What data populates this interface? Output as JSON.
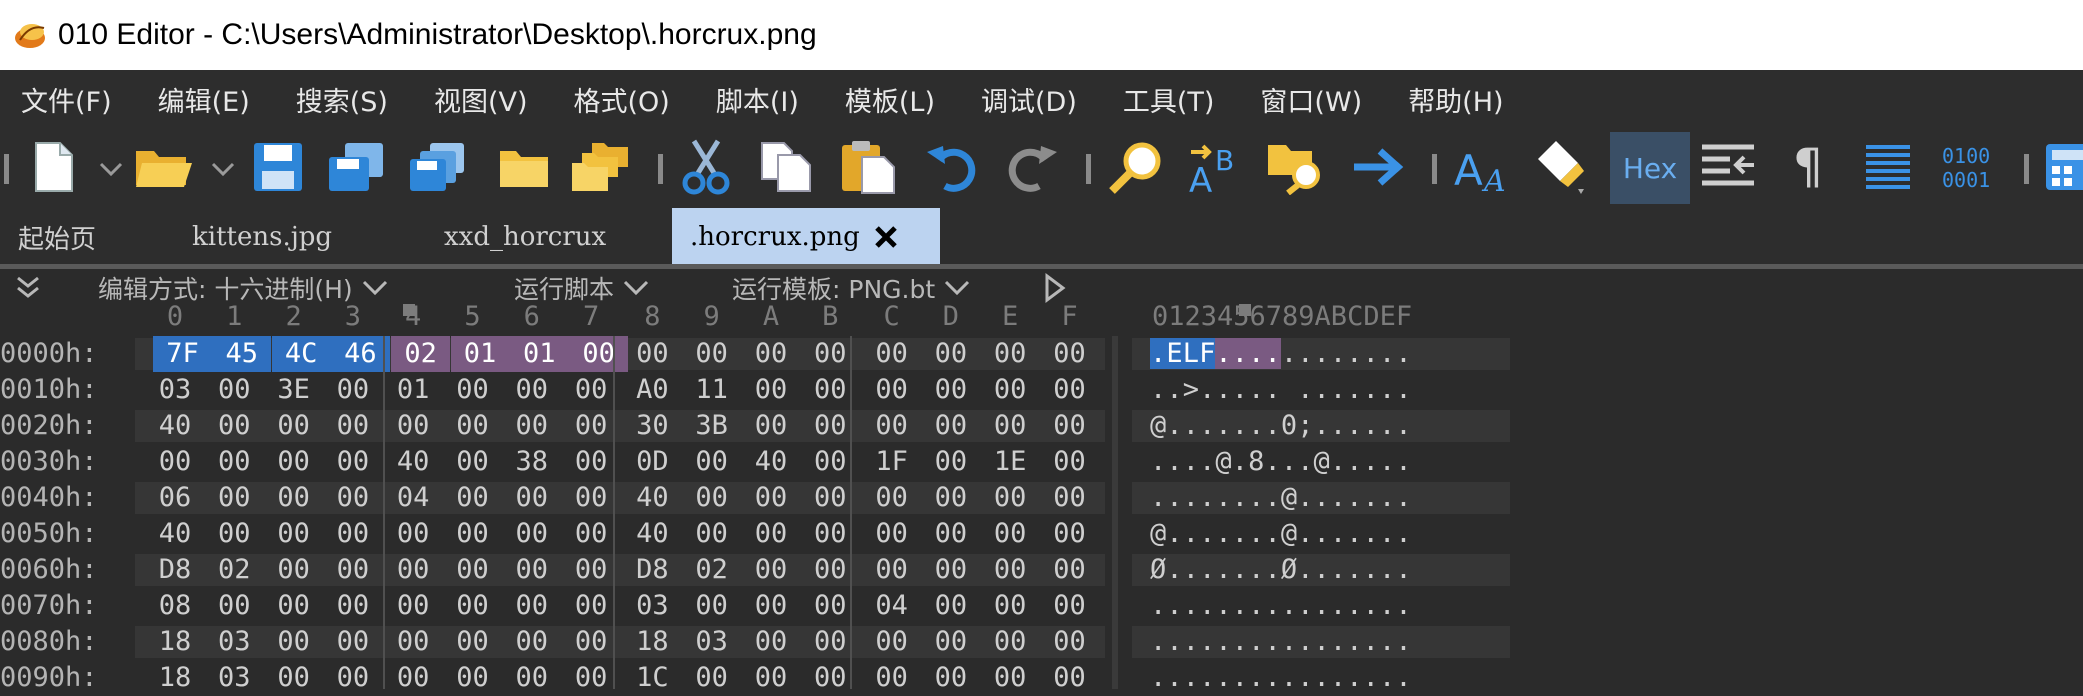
{
  "window": {
    "title": "010 Editor - C:\\Users\\Administrator\\Desktop\\.horcrux.png"
  },
  "menu": [
    "文件(F)",
    "编辑(E)",
    "搜索(S)",
    "视图(V)",
    "格式(O)",
    "脚本(I)",
    "模板(L)",
    "调试(D)",
    "工具(T)",
    "窗口(W)",
    "帮助(H)"
  ],
  "toolbar": {
    "icons": [
      "new-file-icon",
      "open-folder-icon",
      "save-icon",
      "save-as-icon",
      "save-all-icon",
      "folder-icon",
      "folders-icon",
      "cut-icon",
      "copy-icon",
      "paste-icon",
      "undo-icon",
      "redo-icon",
      "find-icon",
      "replace-icon",
      "find-in-files-icon",
      "goto-icon",
      "font-icon",
      "highlight-icon",
      "hex-mode-icon",
      "compare-icon",
      "pilcrow-icon",
      "columns-icon",
      "binary-icon",
      "calculator-icon"
    ],
    "hex_label": "Hex",
    "binary_label": "0100\n0001"
  },
  "tabs": [
    {
      "label": "起始页"
    },
    {
      "label": "kittens.jpg"
    },
    {
      "label": "xxd_horcrux"
    },
    {
      "label": ".horcrux.png",
      "active": true
    }
  ],
  "options": {
    "edit_mode": "编辑方式: 十六进制(H)",
    "run_script": "运行脚本",
    "run_template": "运行模板: PNG.bt"
  },
  "hex": {
    "column_headers": [
      "0",
      "1",
      "2",
      "3",
      "4",
      "5",
      "6",
      "7",
      "8",
      "9",
      "A",
      "B",
      "C",
      "D",
      "E",
      "F"
    ],
    "ascii_header": "0123456789ABCDEF",
    "rows": [
      {
        "addr": "0000h:",
        "bytes": [
          "7F",
          "45",
          "4C",
          "46",
          "02",
          "01",
          "01",
          "00",
          "00",
          "00",
          "00",
          "00",
          "00",
          "00",
          "00",
          "00"
        ],
        "ascii": ".ELF............"
      },
      {
        "addr": "0010h:",
        "bytes": [
          "03",
          "00",
          "3E",
          "00",
          "01",
          "00",
          "00",
          "00",
          "A0",
          "11",
          "00",
          "00",
          "00",
          "00",
          "00",
          "00"
        ],
        "ascii": "..>..... ......."
      },
      {
        "addr": "0020h:",
        "bytes": [
          "40",
          "00",
          "00",
          "00",
          "00",
          "00",
          "00",
          "00",
          "30",
          "3B",
          "00",
          "00",
          "00",
          "00",
          "00",
          "00"
        ],
        "ascii": "@.......0;......"
      },
      {
        "addr": "0030h:",
        "bytes": [
          "00",
          "00",
          "00",
          "00",
          "40",
          "00",
          "38",
          "00",
          "0D",
          "00",
          "40",
          "00",
          "1F",
          "00",
          "1E",
          "00"
        ],
        "ascii": "....@.8...@....."
      },
      {
        "addr": "0040h:",
        "bytes": [
          "06",
          "00",
          "00",
          "00",
          "04",
          "00",
          "00",
          "00",
          "40",
          "00",
          "00",
          "00",
          "00",
          "00",
          "00",
          "00"
        ],
        "ascii": "........@......."
      },
      {
        "addr": "0050h:",
        "bytes": [
          "40",
          "00",
          "00",
          "00",
          "00",
          "00",
          "00",
          "00",
          "40",
          "00",
          "00",
          "00",
          "00",
          "00",
          "00",
          "00"
        ],
        "ascii": "@.......@......."
      },
      {
        "addr": "0060h:",
        "bytes": [
          "D8",
          "02",
          "00",
          "00",
          "00",
          "00",
          "00",
          "00",
          "D8",
          "02",
          "00",
          "00",
          "00",
          "00",
          "00",
          "00"
        ],
        "ascii": "Ø.......Ø......."
      },
      {
        "addr": "0070h:",
        "bytes": [
          "08",
          "00",
          "00",
          "00",
          "00",
          "00",
          "00",
          "00",
          "03",
          "00",
          "00",
          "00",
          "04",
          "00",
          "00",
          "00"
        ],
        "ascii": "................"
      },
      {
        "addr": "0080h:",
        "bytes": [
          "18",
          "03",
          "00",
          "00",
          "00",
          "00",
          "00",
          "00",
          "18",
          "03",
          "00",
          "00",
          "00",
          "00",
          "00",
          "00"
        ],
        "ascii": "................"
      },
      {
        "addr": "0090h:",
        "bytes": [
          "18",
          "03",
          "00",
          "00",
          "00",
          "00",
          "00",
          "00",
          "1C",
          "00",
          "00",
          "00",
          "00",
          "00",
          "00",
          "00"
        ],
        "ascii": "................"
      }
    ]
  },
  "colors": {
    "selection_blue": "#2f6fbf",
    "selection_purple": "#7a5a82",
    "row_stripe": "#363636",
    "active_tab": "#bcd3f0"
  }
}
